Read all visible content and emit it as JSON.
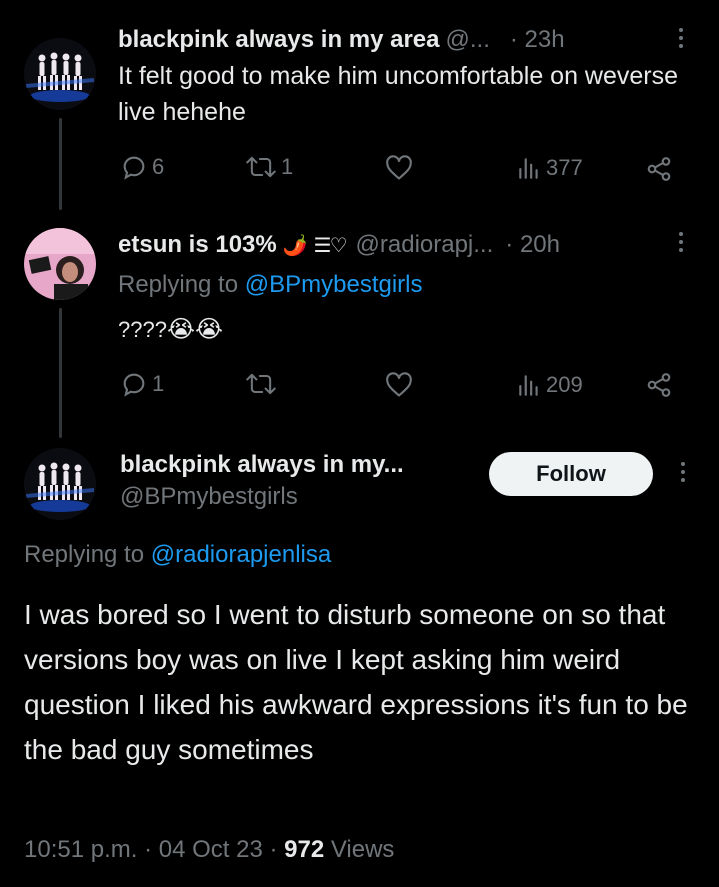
{
  "tweet1": {
    "name": "blackpink always in my area",
    "handle": "@...",
    "time": "· 23h",
    "text": "It felt good to make him uncomfortable on weverse live hehehe",
    "replies": "6",
    "retweets": "1",
    "likes": "",
    "views": "377",
    "avatar_icon": "dancers-avatar"
  },
  "tweet2": {
    "name": "etsun is 103%",
    "name_emoji": "🌶️",
    "name_symbol": "☰♡",
    "handle": "@radiorapj...",
    "time": "· 20h",
    "replying_prefix": "Replying to ",
    "replying_to": "@BPmybestgirls",
    "text": "????",
    "text_emoji": "😭😭",
    "replies": "1",
    "retweets": "",
    "likes": "",
    "views": "209",
    "avatar_icon": "pink-portrait-avatar"
  },
  "tweet3": {
    "name": "blackpink always in my...",
    "handle": "@BPmybestgirls",
    "follow_label": "Follow",
    "replying_prefix": "Replying to ",
    "replying_to": "@radiorapjenlisa",
    "text": "I was bored so I went to disturb someone on so that versions boy was on live I kept asking him weird question I liked his awkward expressions it's fun to be the bad guy sometimes",
    "timestamp": "10:51 p.m. · 04 Oct 23 · ",
    "views_count": "972",
    "views_label": " Views",
    "avatar_icon": "dancers-avatar"
  },
  "colors": {
    "background": "#000000",
    "text": "#e7e9ea",
    "muted": "#71767b",
    "link": "#1d9bf0",
    "follow_bg": "#eff3f4"
  }
}
